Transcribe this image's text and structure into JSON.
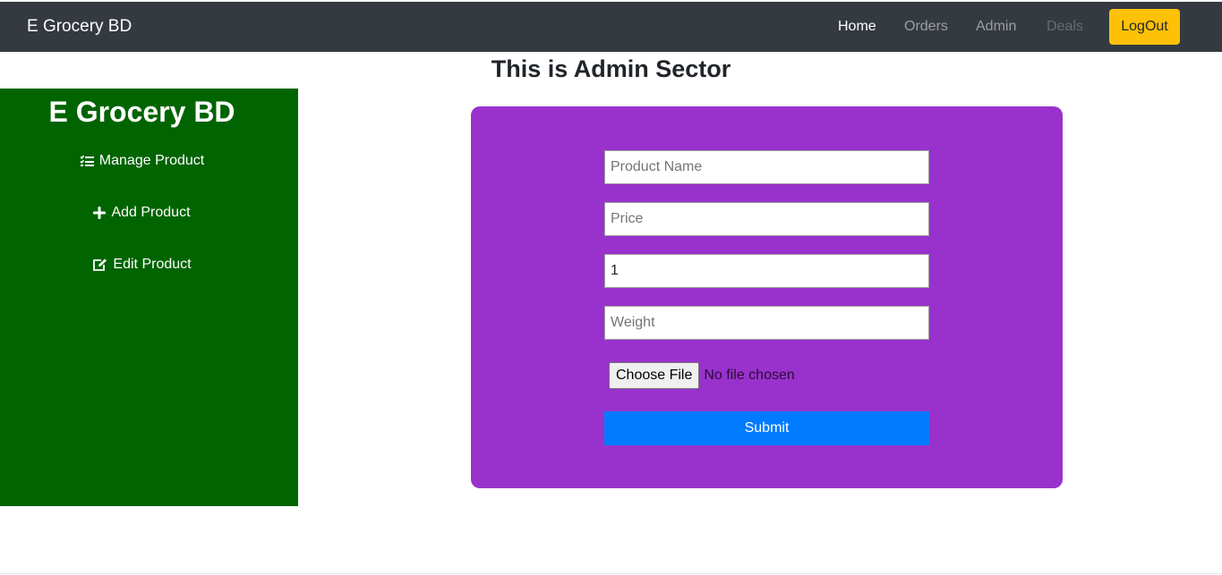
{
  "navbar": {
    "brand": "E Grocery BD",
    "links": {
      "home": "Home",
      "orders": "Orders",
      "admin": "Admin",
      "deals": "Deals"
    },
    "logout_label": "LogOut",
    "background": "#343a40",
    "logout_color": "#ffc107"
  },
  "page": {
    "title": "This is Admin Sector"
  },
  "sidebar": {
    "brand": "E Grocery BD",
    "background": "#006400",
    "items": [
      {
        "label": "Manage Product",
        "icon": "tasks-list-icon"
      },
      {
        "label": "Add Product",
        "icon": "plus-icon"
      },
      {
        "label": "Edit Product",
        "icon": "edit-icon"
      }
    ]
  },
  "form": {
    "background": "#9932cc",
    "product_name": {
      "placeholder": "Product Name",
      "value": ""
    },
    "price": {
      "placeholder": "Price",
      "value": ""
    },
    "quantity": {
      "placeholder": "",
      "value": "1"
    },
    "weight": {
      "placeholder": "Weight",
      "value": ""
    },
    "file": {
      "button_label": "Choose File",
      "status": "No file chosen"
    },
    "submit_label": "Submit",
    "submit_color": "#007bff"
  }
}
